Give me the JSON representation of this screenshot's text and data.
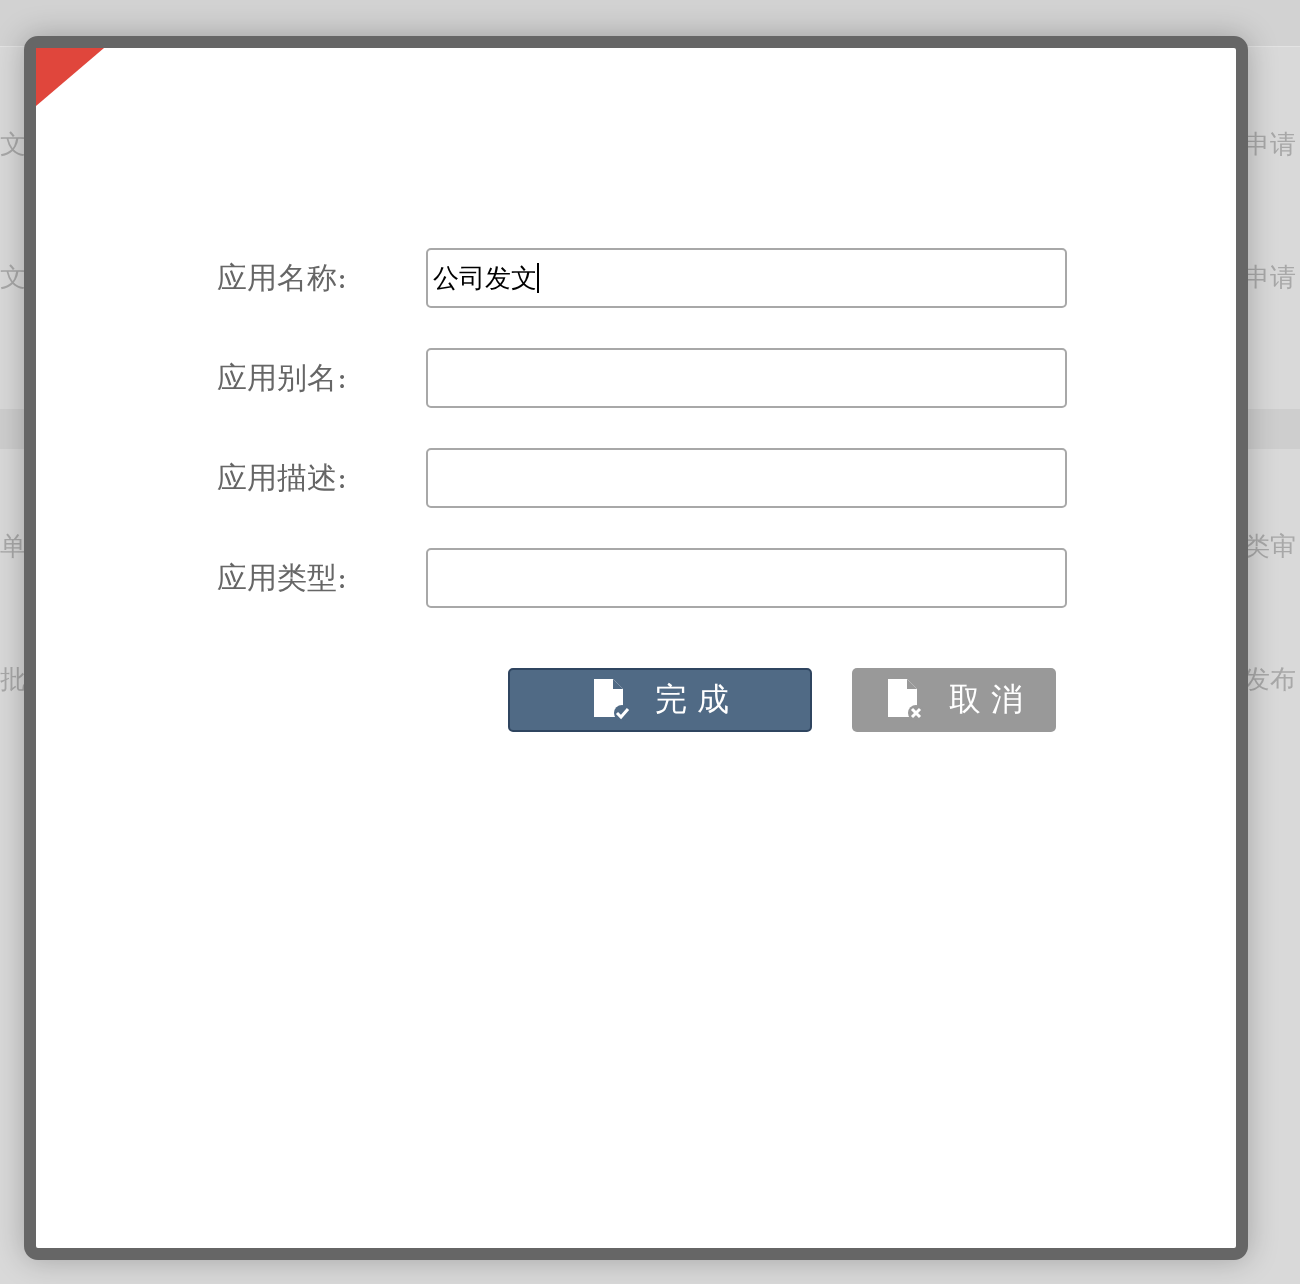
{
  "background_rows": [
    {
      "left": "文",
      "right": "申请"
    },
    {
      "left": "文",
      "right": "申请"
    },
    {
      "left": "单",
      "right": "类审"
    },
    {
      "left": "批",
      "right": "发布"
    }
  ],
  "dialog": {
    "fields": [
      {
        "label": "应用名称:",
        "value": "公司发文"
      },
      {
        "label": "应用别名:"
      },
      {
        "label": "应用描述:"
      },
      {
        "label": "应用类型:"
      }
    ],
    "buttons": [
      {
        "kind": "primary",
        "label": "完 成"
      },
      {
        "kind": "secondary",
        "label": "取 消"
      }
    ]
  }
}
